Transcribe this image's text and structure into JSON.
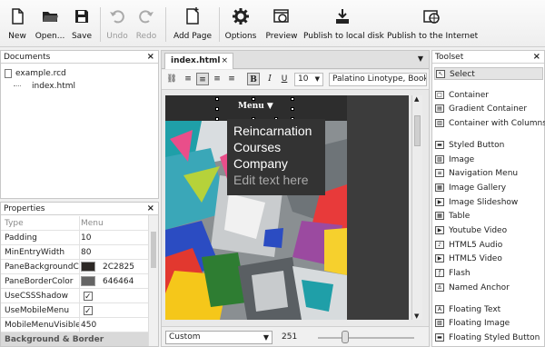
{
  "toolbar": {
    "items": [
      {
        "label": "New",
        "icon": "new-document-icon",
        "enabled": true
      },
      {
        "label": "Open...",
        "icon": "open-folder-icon",
        "enabled": true
      },
      {
        "label": "Save",
        "icon": "save-disk-icon",
        "enabled": true
      },
      {
        "label": "Undo",
        "icon": "undo-icon",
        "enabled": false
      },
      {
        "label": "Redo",
        "icon": "redo-icon",
        "enabled": false
      },
      {
        "label": "Add Page",
        "icon": "add-page-icon",
        "enabled": true
      },
      {
        "label": "Options",
        "icon": "gear-icon",
        "enabled": true
      },
      {
        "label": "Preview",
        "icon": "preview-browser-icon",
        "enabled": true
      },
      {
        "label": "Publish to local disk",
        "icon": "download-disk-icon",
        "enabled": true
      },
      {
        "label": "Publish to the Internet",
        "icon": "publish-globe-icon",
        "enabled": true
      }
    ]
  },
  "documents": {
    "title": "Documents",
    "close": "×",
    "tree": [
      {
        "label": "example.rcd",
        "depth": 0
      },
      {
        "label": "index.html",
        "depth": 1
      }
    ]
  },
  "properties": {
    "title": "Properties",
    "close": "×",
    "header": {
      "key": "Type",
      "value": "Menu"
    },
    "rows": [
      {
        "key": "Padding",
        "value": "10"
      },
      {
        "key": "MinEntryWidth",
        "value": "80"
      },
      {
        "key": "PaneBackgroundCo",
        "value": "2C2825",
        "color": "#2c2825"
      },
      {
        "key": "PaneBorderColor",
        "value": "646464",
        "color": "#646464"
      },
      {
        "key": "UseCSSShadow",
        "value": "",
        "checked": true
      },
      {
        "key": "UseMobileMenu",
        "value": "",
        "checked": true
      },
      {
        "key": "MobileMenuVisible",
        "value": "450"
      }
    ],
    "section": "Background & Border"
  },
  "editor": {
    "tab_label": "index.html",
    "tab_close": "×",
    "font_size": "10",
    "font_family": "Palatino Linotype, Book",
    "menu_label": "Menu",
    "dropdown_items": [
      "Reincarnation",
      "Courses",
      "Company"
    ],
    "dropdown_placeholder": "Edit text here",
    "zoom_mode": "Custom",
    "zoom_value": "251",
    "zoom_slider_fraction": 0.28
  },
  "toolset": {
    "title": "Toolset",
    "close": "×",
    "groups": [
      [
        "Select"
      ],
      [
        "Container",
        "Gradient Container",
        "Container with Columns"
      ],
      [
        "Styled Button",
        "Image",
        "Navigation Menu",
        "Image Gallery",
        "Image Slideshow",
        "Table",
        "Youtube Video",
        "HTML5 Audio",
        "HTML5 Video",
        "Flash",
        "Named Anchor"
      ],
      [
        "Floating Text",
        "Floating Image",
        "Floating Styled Button"
      ]
    ]
  },
  "colors": {
    "dropdown_bg": "#333333",
    "canvas_bg": "#3c3c3c",
    "muted_text": "#aaaaaa"
  }
}
